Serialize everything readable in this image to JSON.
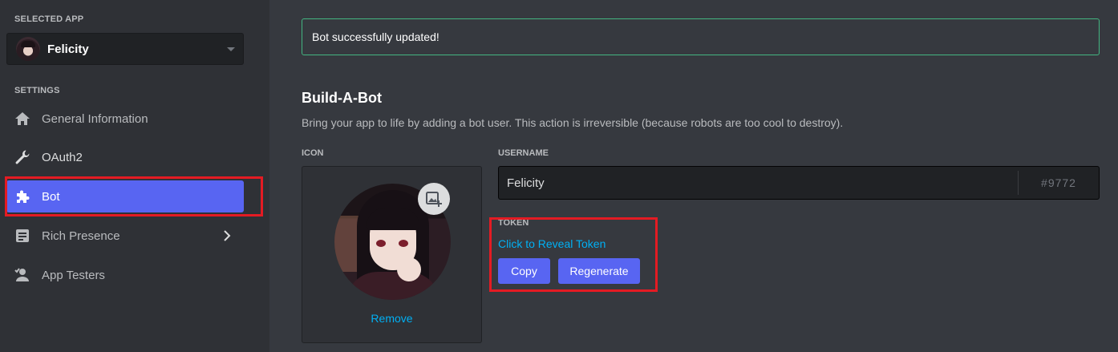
{
  "sidebar": {
    "selected_app_label": "SELECTED APP",
    "app_name": "Felicity",
    "settings_label": "SETTINGS",
    "items": [
      {
        "label": "General Information",
        "icon": "home-icon"
      },
      {
        "label": "OAuth2",
        "icon": "wrench-icon"
      },
      {
        "label": "Bot",
        "icon": "puzzle-icon",
        "active": true
      },
      {
        "label": "Rich Presence",
        "icon": "document-icon",
        "expandable": true
      },
      {
        "label": "App Testers",
        "icon": "user-check-icon"
      }
    ]
  },
  "alert": {
    "message": "Bot successfully updated!",
    "color": "#43b581"
  },
  "bot": {
    "title": "Build-A-Bot",
    "description": "Bring your app to life by adding a bot user. This action is irreversible (because robots are too cool to destroy).",
    "icon_label": "ICON",
    "remove_label": "Remove",
    "username_label": "USERNAME",
    "username_value": "Felicity",
    "discriminator": "#9772",
    "token_label": "TOKEN",
    "reveal_label": "Click to Reveal Token",
    "copy_label": "Copy",
    "regenerate_label": "Regenerate"
  },
  "colors": {
    "accent": "#5865f2",
    "link": "#00b0f4",
    "highlight": "#e41b23",
    "success": "#43b581"
  }
}
